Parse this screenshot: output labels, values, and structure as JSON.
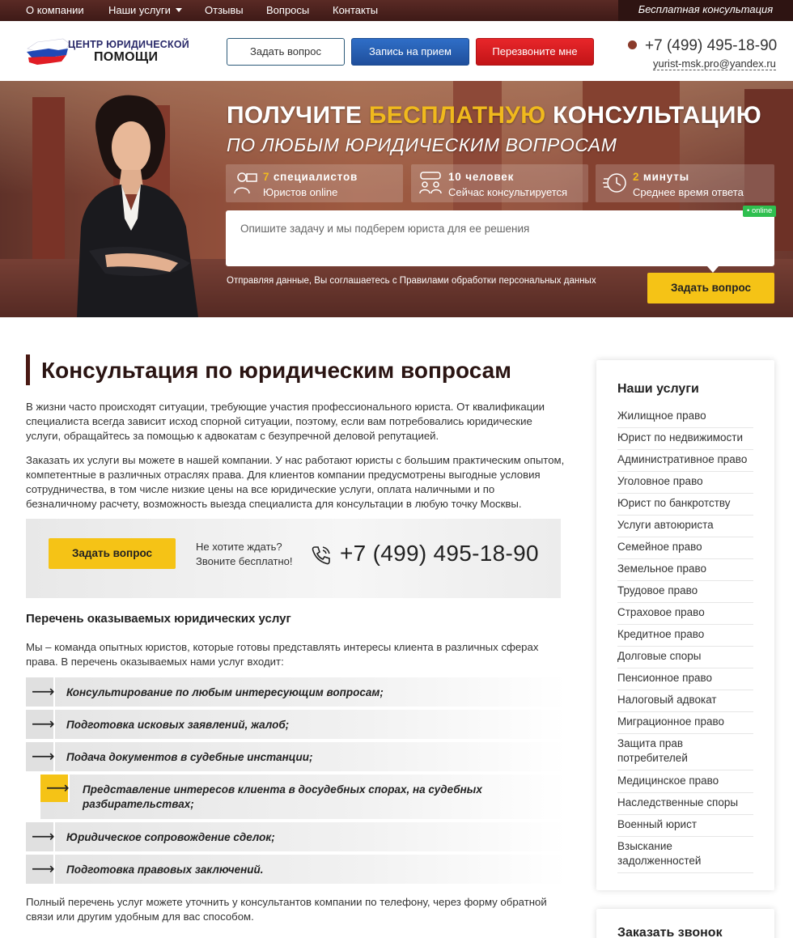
{
  "nav": {
    "items": [
      "О компании",
      "Наши услуги",
      "Отзывы",
      "Вопросы",
      "Контакты"
    ],
    "free_consult": "Бесплатная консультация"
  },
  "header": {
    "logo_line1": "ЦЕНТР ЮРИДИЧЕСКОЙ",
    "logo_line2": "ПОМОЩИ",
    "btn_question": "Задать вопрос",
    "btn_appointment": "Запись на прием",
    "btn_callback": "Перезвоните мне",
    "phone": "+7 (499) 495-18-90",
    "email": "yurist-msk.pro@yandex.ru"
  },
  "hero": {
    "title_part1": "ПОЛУЧИТЕ",
    "title_accent": "БЕСПЛАТНУЮ",
    "title_part2": "КОНСУЛЬТАЦИЮ",
    "subtitle": "ПО ЛЮБЫМ ЮРИДИЧЕСКИМ ВОПРОСАМ",
    "stats": [
      {
        "num": "7",
        "label": "специалистов",
        "desc": "Юристов online",
        "icon": "lawyer-icon"
      },
      {
        "num": "10",
        "label": "человек",
        "desc": "Сейчас консультируется",
        "icon": "people-icon"
      },
      {
        "num": "2",
        "label": "минуты",
        "desc": "Среднее время ответа",
        "icon": "timer-icon"
      }
    ],
    "textarea_placeholder": "Опишите задачу и мы подберем юриста для ее решения",
    "online_badge": "• online",
    "agree": "Отправляя данные, Вы соглашаетесь с Правилами обработки персональных данных",
    "submit": "Задать вопрос"
  },
  "main": {
    "title": "Консультация по юридическим вопросам",
    "para1": "В жизни часто происходят ситуации, требующие участия профессионального юриста. От квалификации специалиста всегда зависит исход спорной ситуации, поэтому, если вам потребовались юридические услуги, обращайтесь за помощью к адвокатам с безупречной деловой репутацией.",
    "para2": "Заказать их услуги вы можете в нашей компании. У нас работают юристы с большим практическим опытом, компетентные в различных отраслях права. Для клиентов компании предусмотрены выгодные условия сотрудничества, в том числе низкие цены на все юридические услуги, оплата наличными и по безналичному расчету, возможность выезда специалиста для консультации в любую точку Москвы.",
    "callbox": {
      "btn": "Задать вопрос",
      "line1": "Не хотите ждать?",
      "line2": "Звоните бесплатно!",
      "phone": "+7 (499) 495-18-90"
    },
    "list_title": "Перечень оказываемых юридических услуг",
    "list_intro": "Мы – команда опытных юристов, которые готовы представлять интересы клиента в различных сферах права. В перечень оказываемых нами услуг входит:",
    "list": [
      "Консультирование по любым интересующим вопросам;",
      "Подготовка исковых заявлений, жалоб;",
      "Подача документов в судебные инстанции;",
      "Представление интересов клиента в досудебных спорах, на судебных разбирательствах;",
      "Юридическое сопровождение сделок;",
      "Подготовка правовых заключений."
    ],
    "outro": "Полный перечень услуг можете уточнить у консультантов компании по телефону, через форму обратной связи или другим удобным для вас способом."
  },
  "sidebar": {
    "title": "Наши услуги",
    "items": [
      "Жилищное право",
      "Юрист по недвижимости",
      "Административное право",
      "Уголовное право",
      "Юрист по банкротству",
      "Услуги автоюриста",
      "Семейное право",
      "Земельное право",
      "Трудовое право",
      "Страховое право",
      "Кредитное право",
      "Долговые споры",
      "Пенсионное право",
      "Налоговый адвокат",
      "Миграционное право",
      "Защита прав потребителей",
      "Медицинское право",
      "Наследственные споры",
      "Военный юрист",
      "Взыскание задолженностей"
    ],
    "callback_title": "Заказать звонок"
  },
  "colors": {
    "accent_yellow": "#f5c316",
    "nav_brown": "#4a1f1b",
    "btn_blue": "#2a62b8",
    "btn_red": "#d91c1f"
  }
}
